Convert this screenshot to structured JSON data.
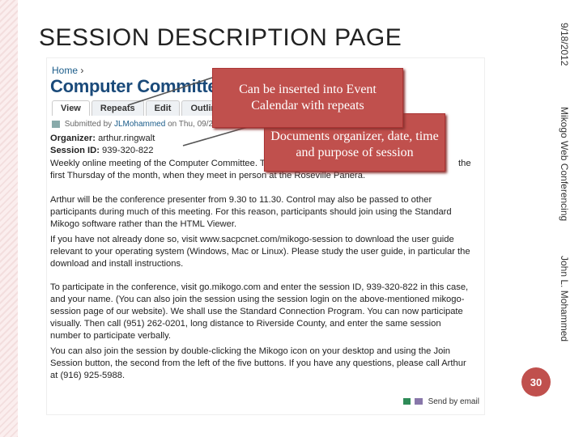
{
  "slide": {
    "title": "SESSION DESCRIPTION PAGE",
    "date": "9/18/2012",
    "footer_org": "Mikogo Web Conferencing",
    "author": "John L. Mohammed",
    "page_number": "30"
  },
  "screenshot": {
    "breadcrumb_home": "Home",
    "breadcrumb_sep": "›",
    "heading": "Computer Committee Wee",
    "tabs": [
      "View",
      "Repeats",
      "Edit",
      "Outline"
    ],
    "submitted_prefix": "Submitted by",
    "submitted_user": "JLMohammed",
    "submitted_on": "on Thu, 09/27",
    "organizer_label": "Organizer:",
    "organizer_value": "arthur.ringwalt",
    "session_label": "Session ID:",
    "session_value": "939-320-822",
    "para1_a": "Weekly online meeting of the Computer Committee. T",
    "para1_b": "the",
    "para1_c": "first Thursday of the month, when they meet in person at the Roseville Panera.",
    "para2": "Arthur will be the conference presenter from 9.30 to 11.30. Control may also be passed to other participants during much of this meeting. For this reason, participants should join using the Standard Mikogo software rather than the HTML Viewer.",
    "para3": "If you have not already done so, visit www.sacpcnet.com/mikogo-session to download the user guide relevant to your operating system (Windows, Mac or Linux). Please study the user guide, in particular the download and install instructions.",
    "para4": "To participate in the conference, visit go.mikogo.com and enter the session ID, 939-320-822 in this case, and your name. (You can also join the session using the session login on the above-mentioned mikogo-session page of our website). We shall use the Standard Connection Program. You can now participate visually. Then call (951) 262-0201, long distance to Riverside County, and enter the same session number to participate verbally.",
    "para5": "You can also join the session by double-clicking the Mikogo icon on your desktop and using the Join Session button, the second from the left of the five buttons. If you have any questions, please call Arthur at (916) 925-5988.",
    "send_email": "Send by email"
  },
  "callouts": {
    "repeats": "Can be inserted into Event Calendar with repeats",
    "organizer": "Documents organizer, date, time and purpose of session"
  },
  "colors": {
    "accent": "#c0504d",
    "heading_blue": "#1a4a7a"
  }
}
